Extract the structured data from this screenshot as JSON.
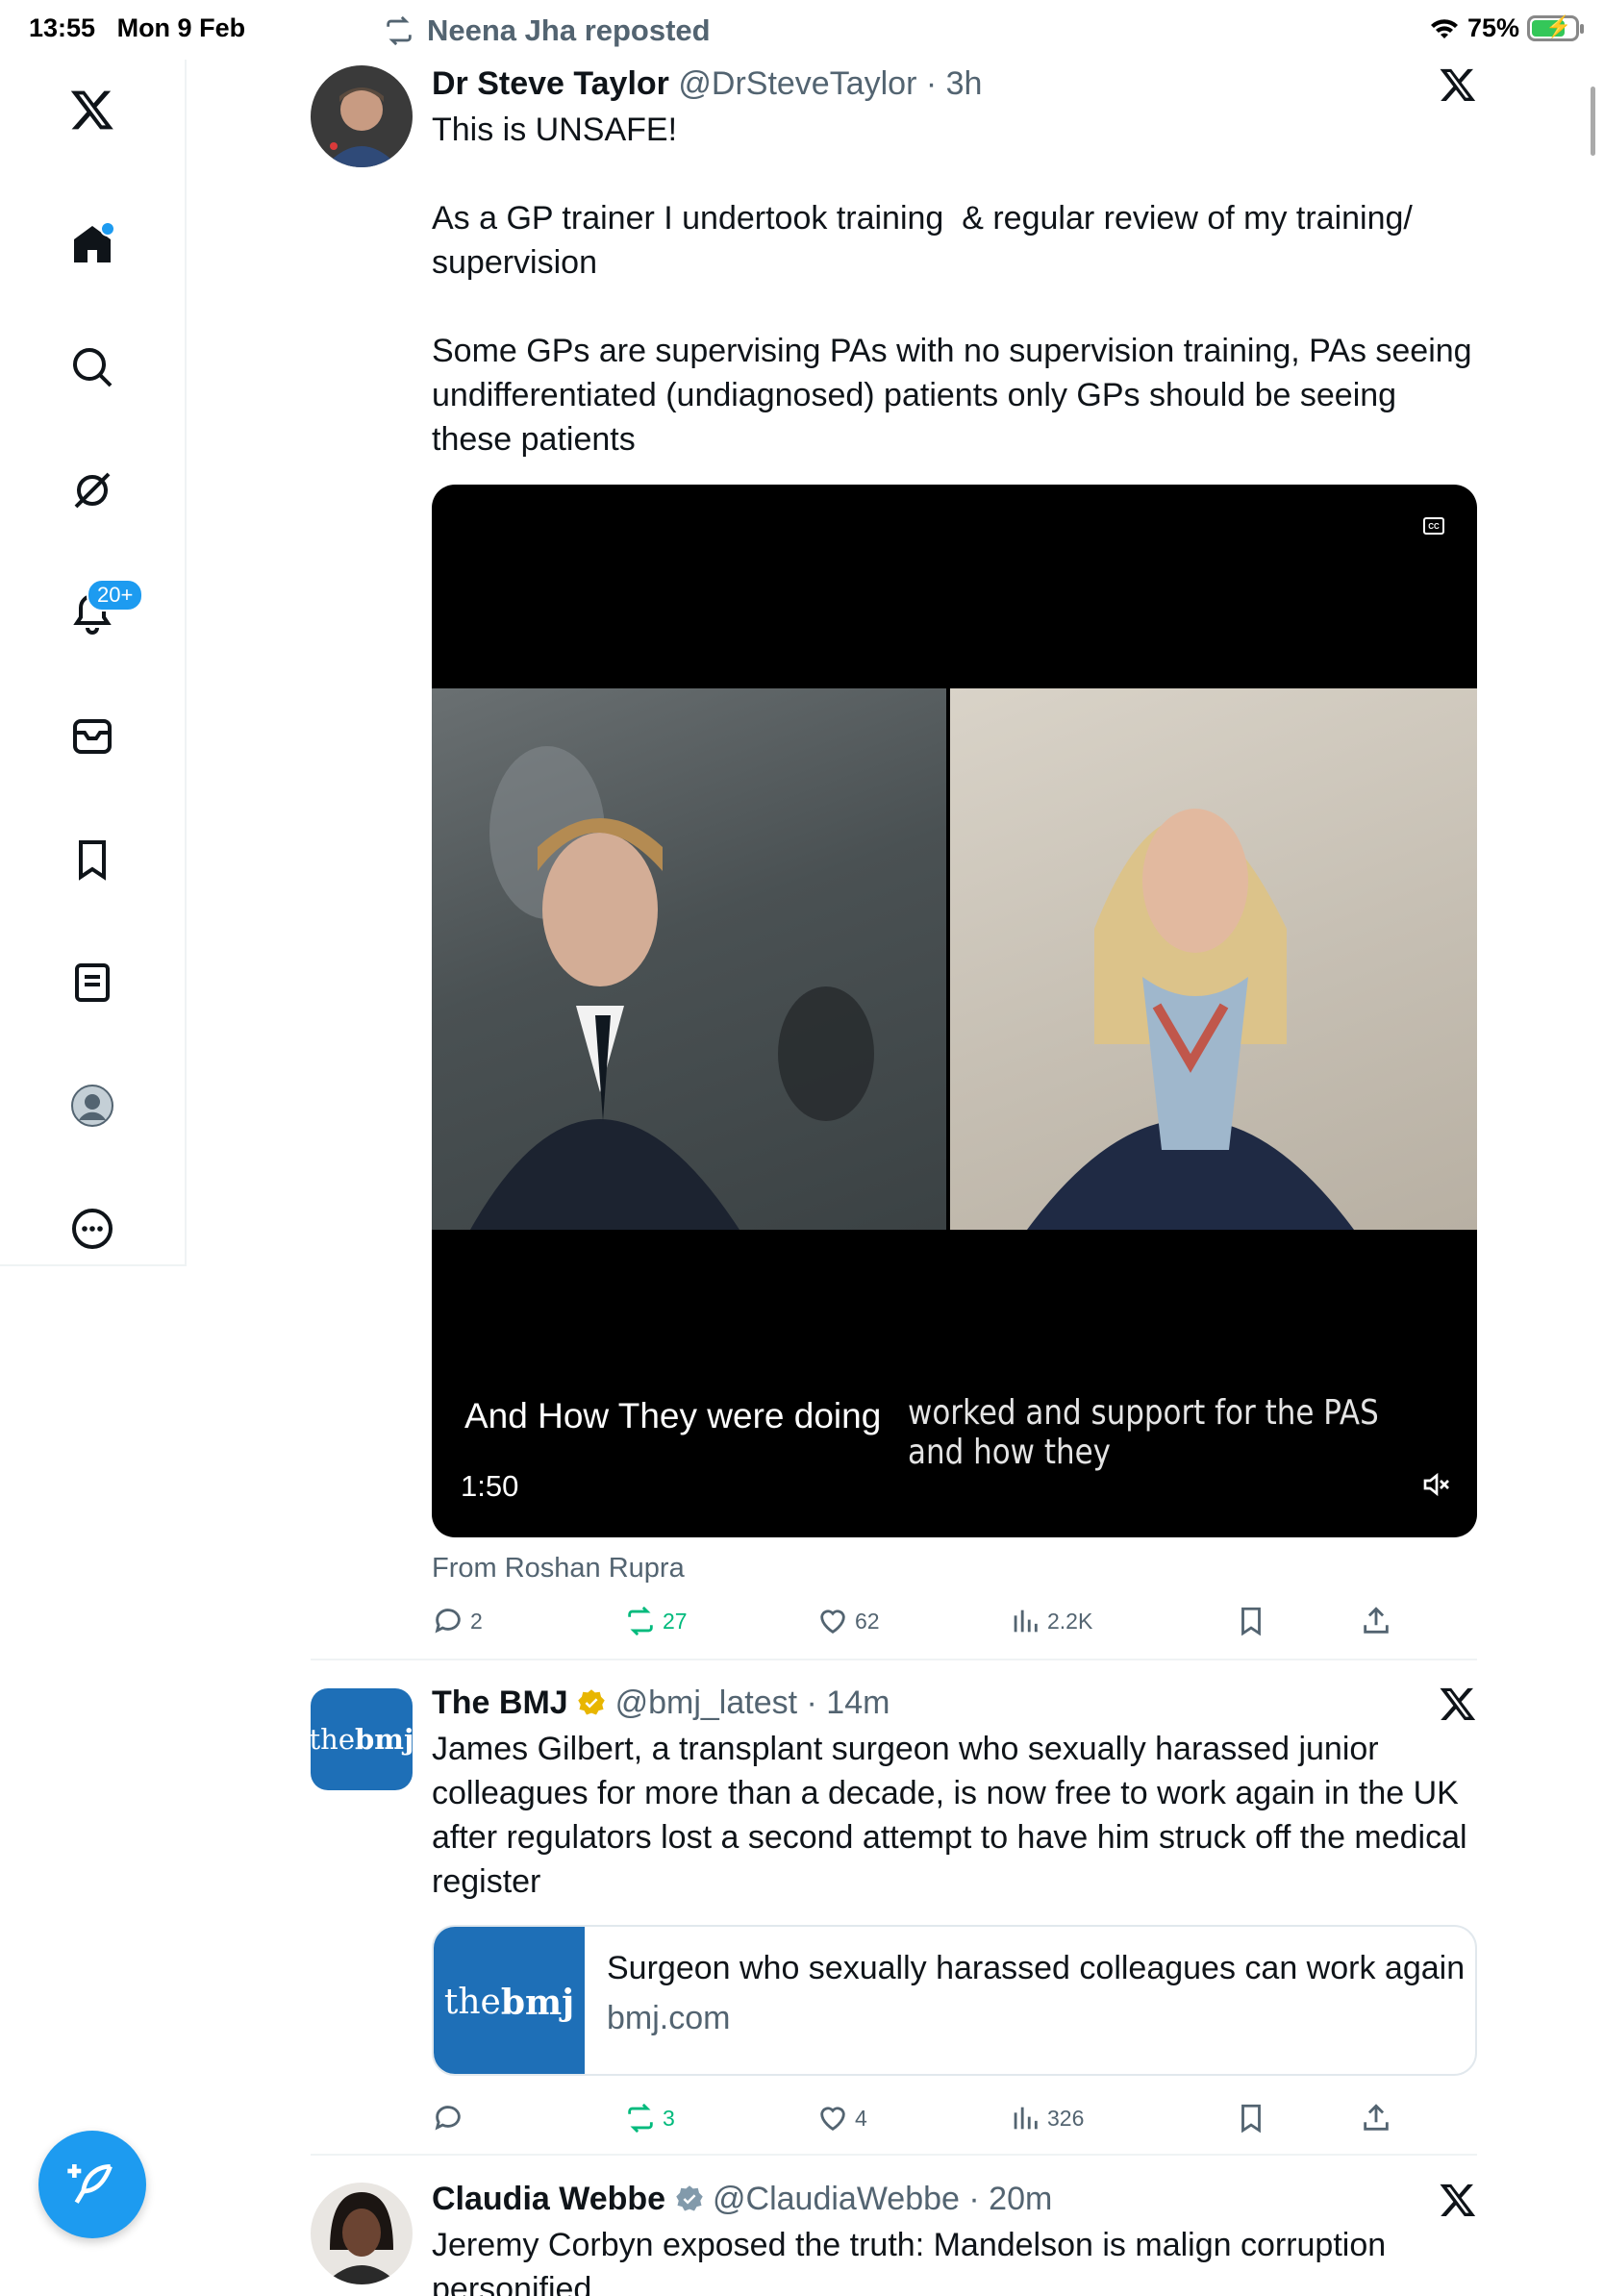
{
  "status_bar": {
    "time": "13:55",
    "date": "Mon 9 Feb",
    "battery": "75%"
  },
  "sidebar": {
    "items": [
      {
        "name": "x-logo"
      },
      {
        "name": "home",
        "has_dot": true
      },
      {
        "name": "search"
      },
      {
        "name": "grok"
      },
      {
        "name": "notifications",
        "badge": "20+"
      },
      {
        "name": "messages"
      },
      {
        "name": "bookmarks"
      },
      {
        "name": "lists"
      },
      {
        "name": "profile"
      },
      {
        "name": "more"
      }
    ]
  },
  "posts": [
    {
      "repost_label": "Neena Jha reposted",
      "author": "Dr Steve Taylor",
      "handle": "@DrSteveTaylor",
      "time": "3h",
      "text": "This is UNSAFE!\n\nAs a GP trainer I undertook training  & regular review of my training/ supervision\n\nSome GPs are supervising PAs with no supervision training, PAs seeing undifferentiated (undiagnosed) patients only GPs should be seeing these patients",
      "video": {
        "caption_main": "And How They were doing",
        "caption_overlay": "worked and support for the PAS and how they",
        "duration": "1:50",
        "cc_label": "CC"
      },
      "from": "From Roshan Rupra",
      "stats": {
        "replies": "2",
        "reposts": "27",
        "likes": "62",
        "views": "2.2K"
      }
    },
    {
      "author": "The BMJ",
      "handle": "@bmj_latest",
      "time": "14m",
      "avatar_text_a": "the",
      "avatar_text_b": "bmj",
      "text": "James Gilbert, a transplant surgeon who sexually harassed junior colleagues for more than a decade, is now free to work again in the UK after regulators lost a second attempt to have him struck off the medical register",
      "link_card": {
        "title": "Surgeon who sexually harassed colleagues can work again",
        "domain": "bmj.com",
        "thumb_a": "the",
        "thumb_b": "bmj"
      },
      "stats": {
        "replies": "",
        "reposts": "3",
        "likes": "4",
        "views": "326"
      }
    },
    {
      "author": "Claudia Webbe",
      "handle": "@ClaudiaWebbe",
      "time": "20m",
      "text": "Jeremy Corbyn exposed the truth: Mandelson is malign corruption personified"
    }
  ],
  "colors": {
    "accent": "#1d9bf0",
    "repost_green": "#00ba7c",
    "muted": "#536471",
    "gold_badge": "#e8b600",
    "bmj_blue": "#1e6fb7"
  }
}
